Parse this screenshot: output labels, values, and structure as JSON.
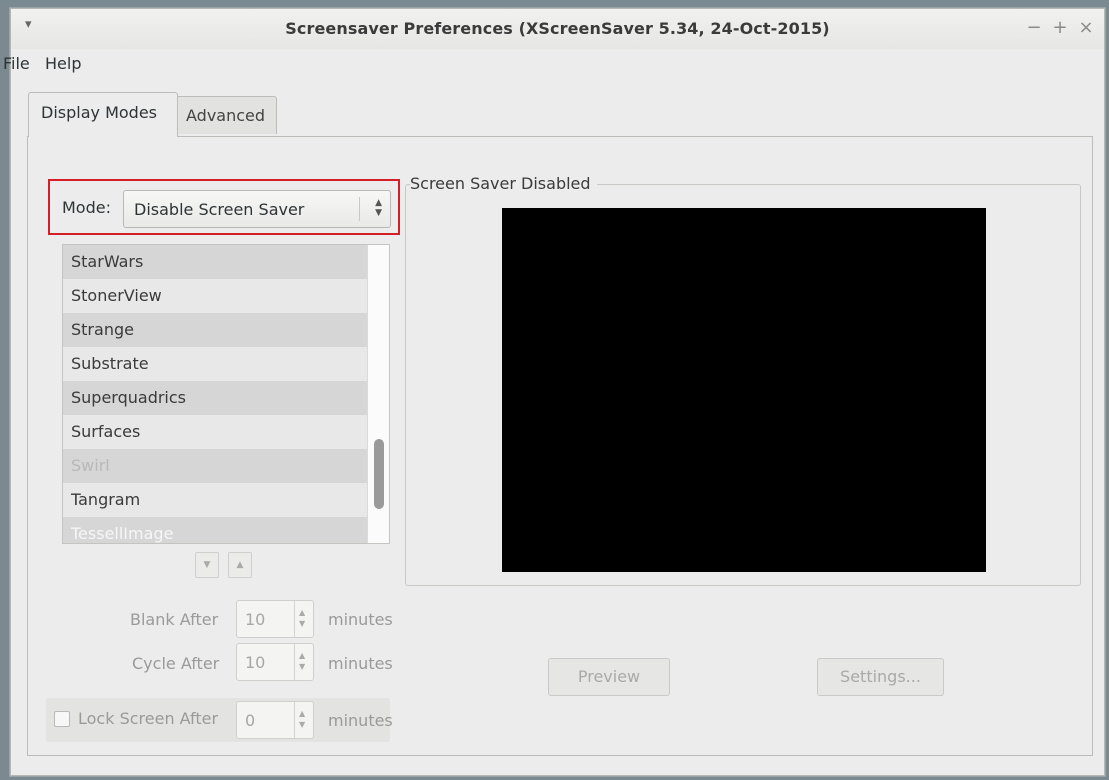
{
  "window": {
    "title": "Screensaver Preferences  (XScreenSaver 5.34, 24-Oct-2015)",
    "controls": {
      "minimize": "−",
      "maximize": "+",
      "close": "×"
    },
    "menu_arrow": "▾"
  },
  "menubar": {
    "file": "File",
    "help": "Help"
  },
  "tabs": [
    {
      "label": "Display Modes",
      "active": true
    },
    {
      "label": "Advanced",
      "active": false
    }
  ],
  "mode": {
    "label": "Mode:",
    "value": "Disable Screen Saver"
  },
  "screensaver_list": {
    "items": [
      "StarWars",
      "StonerView",
      "Strange",
      "Substrate",
      "Superquadrics",
      "Surfaces",
      "Swirl",
      "Tangram",
      "TessellImage"
    ]
  },
  "list_nav": {
    "down": "▼",
    "up": "▲"
  },
  "blank_after": {
    "label": "Blank After",
    "value": "10",
    "unit": "minutes"
  },
  "cycle_after": {
    "label": "Cycle After",
    "value": "10",
    "unit": "minutes"
  },
  "lock_screen": {
    "label": "Lock Screen After",
    "value": "0",
    "unit": "minutes",
    "checked": false
  },
  "preview_panel": {
    "title": "Screen Saver Disabled"
  },
  "buttons": {
    "preview": "Preview",
    "settings": "Settings..."
  }
}
